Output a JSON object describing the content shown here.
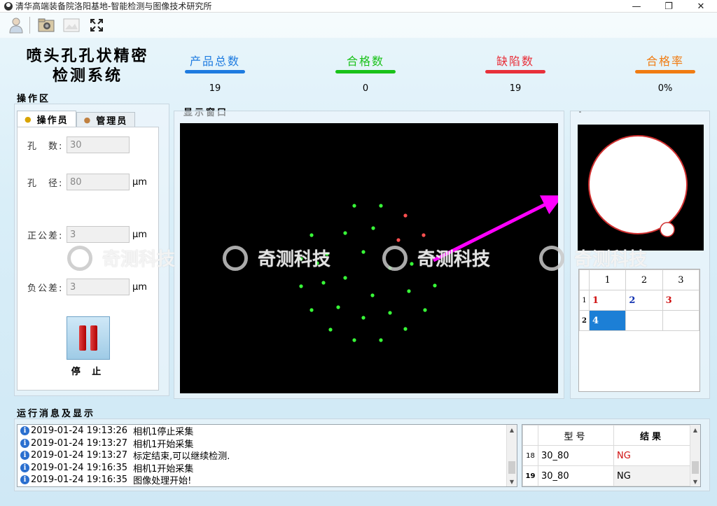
{
  "window": {
    "title": "清华高端装备院洛阳基地-智能检测与图像技术研究所",
    "minimize": "—",
    "maximize": "❐",
    "close": "✕"
  },
  "toolbar": {
    "buttons": [
      "user-icon",
      "camera-folder-icon",
      "image-icon",
      "fullscreen-icon"
    ]
  },
  "app": {
    "title_line1": "喷头孔孔状精密",
    "title_line2": "检测系统"
  },
  "stats": [
    {
      "label": "产品总数",
      "value": "19",
      "color": "#1e7be0"
    },
    {
      "label": "合格数",
      "value": "0",
      "color": "#19c219"
    },
    {
      "label": "缺陷数",
      "value": "19",
      "color": "#e8303a"
    },
    {
      "label": "合格率",
      "value": "0%",
      "color": "#f07c12"
    }
  ],
  "operation": {
    "section_label": "操作区",
    "tabs": [
      "操作员",
      "管理员"
    ],
    "fields": [
      {
        "label": "孔　数:",
        "value": "30",
        "unit": ""
      },
      {
        "label": "孔　径:",
        "value": "80",
        "unit": "μm"
      },
      {
        "label": "正公差:",
        "value": "3",
        "unit": "μm"
      },
      {
        "label": "负公差:",
        "value": "3",
        "unit": "μm"
      }
    ],
    "stop_label": "停 止"
  },
  "display": {
    "section_label": "显示窗口",
    "side_label": "."
  },
  "grid": {
    "col_headers": [
      "1",
      "2",
      "3"
    ],
    "row_headers": [
      "1",
      "2"
    ],
    "cells": [
      [
        {
          "text": "1",
          "color": "#d01010"
        },
        {
          "text": "2",
          "color": "#1030b0"
        },
        {
          "text": "3",
          "color": "#d01010"
        }
      ],
      [
        {
          "text": "4",
          "color": "#ffffff"
        },
        {
          "text": "",
          "color": "#000"
        },
        {
          "text": "",
          "color": "#000"
        }
      ]
    ]
  },
  "log": {
    "section_label": "运行消息及显示",
    "lines": [
      {
        "time": "2019-01-24 19:13:26",
        "msg": "相机1停止采集"
      },
      {
        "time": "2019-01-24 19:13:27",
        "msg": "相机1开始采集"
      },
      {
        "time": "2019-01-24 19:13:27",
        "msg": "标定结束,可以继续检测."
      },
      {
        "time": "2019-01-24 19:16:35",
        "msg": "相机1开始采集"
      },
      {
        "time": "2019-01-24 19:16:35",
        "msg": "图像处理开始!"
      }
    ]
  },
  "results": {
    "headers": [
      "型号",
      "结果"
    ],
    "rows": [
      {
        "idx": "18",
        "model": "30_80",
        "result": "NG",
        "color": "#d01010"
      },
      {
        "idx": "19",
        "model": "30_80",
        "result": "NG",
        "color": "#000000"
      }
    ]
  },
  "watermark": "奇测科技"
}
